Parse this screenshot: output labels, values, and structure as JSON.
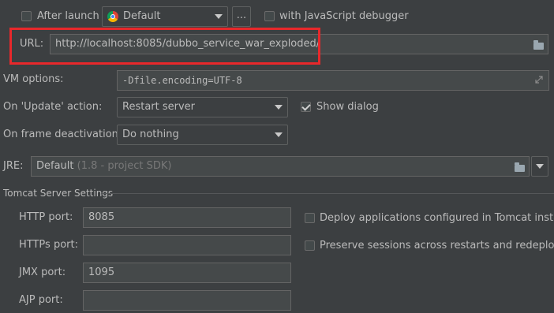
{
  "top_row": {
    "after_launch_label": "After launch",
    "browser_value": "Default",
    "ellipsis_label": "...",
    "js_debugger_label": "with JavaScript debugger"
  },
  "url": {
    "label": "URL:",
    "value": "http://localhost:8085/dubbo_service_war_exploded/"
  },
  "vm_options": {
    "label": "VM options:",
    "value": "-Dfile.encoding=UTF-8"
  },
  "update_action": {
    "label": "On 'Update' action:",
    "value": "Restart server",
    "show_dialog_label": "Show dialog",
    "show_dialog_checked": true
  },
  "frame_deactivation": {
    "label": "On frame deactivation:",
    "value": "Do nothing"
  },
  "jre": {
    "label": "JRE:",
    "value": "Default",
    "hint": "(1.8 - project SDK)"
  },
  "tomcat": {
    "section_title": "Tomcat Server Settings",
    "http_port_label": "HTTP port:",
    "http_port_value": "8085",
    "https_port_label": "HTTPs port:",
    "https_port_value": "",
    "jmx_port_label": "JMX port:",
    "jmx_port_value": "1095",
    "ajp_port_label": "AJP port:",
    "ajp_port_value": "",
    "deploy_label": "Deploy applications configured in Tomcat instance",
    "preserve_label": "Preserve sessions across restarts and redeploys"
  },
  "icons": [
    "chrome-icon",
    "folder-icon",
    "expand-icon",
    "dropdown-arrow-icon"
  ],
  "colors": {
    "background": "#3c3f41",
    "field": "#45494a",
    "highlight": "#e8282b",
    "text": "#bbbbbb"
  }
}
